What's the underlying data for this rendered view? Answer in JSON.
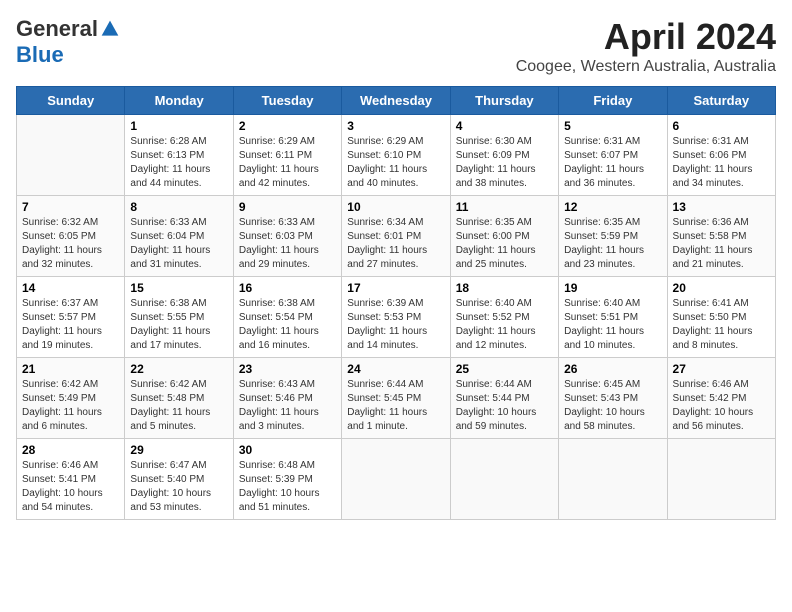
{
  "header": {
    "logo_general": "General",
    "logo_blue": "Blue",
    "title": "April 2024",
    "subtitle": "Coogee, Western Australia, Australia"
  },
  "days": [
    "Sunday",
    "Monday",
    "Tuesday",
    "Wednesday",
    "Thursday",
    "Friday",
    "Saturday"
  ],
  "weeks": [
    [
      {
        "date": "",
        "sunrise": "",
        "sunset": "",
        "daylight": ""
      },
      {
        "date": "1",
        "sunrise": "Sunrise: 6:28 AM",
        "sunset": "Sunset: 6:13 PM",
        "daylight": "Daylight: 11 hours and 44 minutes."
      },
      {
        "date": "2",
        "sunrise": "Sunrise: 6:29 AM",
        "sunset": "Sunset: 6:11 PM",
        "daylight": "Daylight: 11 hours and 42 minutes."
      },
      {
        "date": "3",
        "sunrise": "Sunrise: 6:29 AM",
        "sunset": "Sunset: 6:10 PM",
        "daylight": "Daylight: 11 hours and 40 minutes."
      },
      {
        "date": "4",
        "sunrise": "Sunrise: 6:30 AM",
        "sunset": "Sunset: 6:09 PM",
        "daylight": "Daylight: 11 hours and 38 minutes."
      },
      {
        "date": "5",
        "sunrise": "Sunrise: 6:31 AM",
        "sunset": "Sunset: 6:07 PM",
        "daylight": "Daylight: 11 hours and 36 minutes."
      },
      {
        "date": "6",
        "sunrise": "Sunrise: 6:31 AM",
        "sunset": "Sunset: 6:06 PM",
        "daylight": "Daylight: 11 hours and 34 minutes."
      }
    ],
    [
      {
        "date": "7",
        "sunrise": "Sunrise: 6:32 AM",
        "sunset": "Sunset: 6:05 PM",
        "daylight": "Daylight: 11 hours and 32 minutes."
      },
      {
        "date": "8",
        "sunrise": "Sunrise: 6:33 AM",
        "sunset": "Sunset: 6:04 PM",
        "daylight": "Daylight: 11 hours and 31 minutes."
      },
      {
        "date": "9",
        "sunrise": "Sunrise: 6:33 AM",
        "sunset": "Sunset: 6:03 PM",
        "daylight": "Daylight: 11 hours and 29 minutes."
      },
      {
        "date": "10",
        "sunrise": "Sunrise: 6:34 AM",
        "sunset": "Sunset: 6:01 PM",
        "daylight": "Daylight: 11 hours and 27 minutes."
      },
      {
        "date": "11",
        "sunrise": "Sunrise: 6:35 AM",
        "sunset": "Sunset: 6:00 PM",
        "daylight": "Daylight: 11 hours and 25 minutes."
      },
      {
        "date": "12",
        "sunrise": "Sunrise: 6:35 AM",
        "sunset": "Sunset: 5:59 PM",
        "daylight": "Daylight: 11 hours and 23 minutes."
      },
      {
        "date": "13",
        "sunrise": "Sunrise: 6:36 AM",
        "sunset": "Sunset: 5:58 PM",
        "daylight": "Daylight: 11 hours and 21 minutes."
      }
    ],
    [
      {
        "date": "14",
        "sunrise": "Sunrise: 6:37 AM",
        "sunset": "Sunset: 5:57 PM",
        "daylight": "Daylight: 11 hours and 19 minutes."
      },
      {
        "date": "15",
        "sunrise": "Sunrise: 6:38 AM",
        "sunset": "Sunset: 5:55 PM",
        "daylight": "Daylight: 11 hours and 17 minutes."
      },
      {
        "date": "16",
        "sunrise": "Sunrise: 6:38 AM",
        "sunset": "Sunset: 5:54 PM",
        "daylight": "Daylight: 11 hours and 16 minutes."
      },
      {
        "date": "17",
        "sunrise": "Sunrise: 6:39 AM",
        "sunset": "Sunset: 5:53 PM",
        "daylight": "Daylight: 11 hours and 14 minutes."
      },
      {
        "date": "18",
        "sunrise": "Sunrise: 6:40 AM",
        "sunset": "Sunset: 5:52 PM",
        "daylight": "Daylight: 11 hours and 12 minutes."
      },
      {
        "date": "19",
        "sunrise": "Sunrise: 6:40 AM",
        "sunset": "Sunset: 5:51 PM",
        "daylight": "Daylight: 11 hours and 10 minutes."
      },
      {
        "date": "20",
        "sunrise": "Sunrise: 6:41 AM",
        "sunset": "Sunset: 5:50 PM",
        "daylight": "Daylight: 11 hours and 8 minutes."
      }
    ],
    [
      {
        "date": "21",
        "sunrise": "Sunrise: 6:42 AM",
        "sunset": "Sunset: 5:49 PM",
        "daylight": "Daylight: 11 hours and 6 minutes."
      },
      {
        "date": "22",
        "sunrise": "Sunrise: 6:42 AM",
        "sunset": "Sunset: 5:48 PM",
        "daylight": "Daylight: 11 hours and 5 minutes."
      },
      {
        "date": "23",
        "sunrise": "Sunrise: 6:43 AM",
        "sunset": "Sunset: 5:46 PM",
        "daylight": "Daylight: 11 hours and 3 minutes."
      },
      {
        "date": "24",
        "sunrise": "Sunrise: 6:44 AM",
        "sunset": "Sunset: 5:45 PM",
        "daylight": "Daylight: 11 hours and 1 minute."
      },
      {
        "date": "25",
        "sunrise": "Sunrise: 6:44 AM",
        "sunset": "Sunset: 5:44 PM",
        "daylight": "Daylight: 10 hours and 59 minutes."
      },
      {
        "date": "26",
        "sunrise": "Sunrise: 6:45 AM",
        "sunset": "Sunset: 5:43 PM",
        "daylight": "Daylight: 10 hours and 58 minutes."
      },
      {
        "date": "27",
        "sunrise": "Sunrise: 6:46 AM",
        "sunset": "Sunset: 5:42 PM",
        "daylight": "Daylight: 10 hours and 56 minutes."
      }
    ],
    [
      {
        "date": "28",
        "sunrise": "Sunrise: 6:46 AM",
        "sunset": "Sunset: 5:41 PM",
        "daylight": "Daylight: 10 hours and 54 minutes."
      },
      {
        "date": "29",
        "sunrise": "Sunrise: 6:47 AM",
        "sunset": "Sunset: 5:40 PM",
        "daylight": "Daylight: 10 hours and 53 minutes."
      },
      {
        "date": "30",
        "sunrise": "Sunrise: 6:48 AM",
        "sunset": "Sunset: 5:39 PM",
        "daylight": "Daylight: 10 hours and 51 minutes."
      },
      {
        "date": "",
        "sunrise": "",
        "sunset": "",
        "daylight": ""
      },
      {
        "date": "",
        "sunrise": "",
        "sunset": "",
        "daylight": ""
      },
      {
        "date": "",
        "sunrise": "",
        "sunset": "",
        "daylight": ""
      },
      {
        "date": "",
        "sunrise": "",
        "sunset": "",
        "daylight": ""
      }
    ]
  ]
}
